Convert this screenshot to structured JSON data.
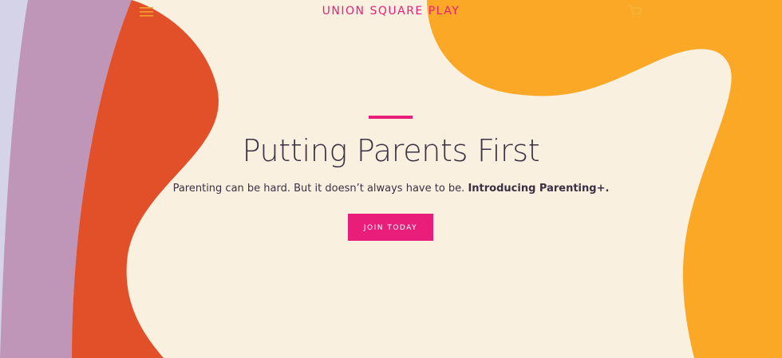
{
  "header": {
    "brand": "UNION SQUARE PLAY",
    "menu_icon": "hamburger-menu-icon",
    "cart_icon": "shopping-cart-icon"
  },
  "hero": {
    "title": "Putting Parents First",
    "subtitle_text": "Parenting can be hard. But it doesn’t always have to be. ",
    "subtitle_emphasis": "Introducing Parenting+.",
    "cta_label": "JOIN TODAY"
  },
  "colors": {
    "background": "#f9f0df",
    "lavender": "#d5d3e8",
    "mauve": "#c096b8",
    "orange_red": "#e2502a",
    "orange_yellow": "#fba826",
    "accent_pink": "#e91e7a",
    "text_dark": "#3a3145"
  }
}
